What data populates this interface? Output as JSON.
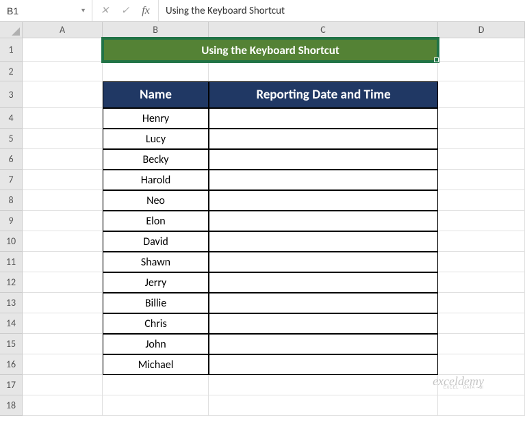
{
  "nameBox": "B1",
  "formulaValue": "Using the Keyboard Shortcut",
  "fx": {
    "cancel": "✕",
    "enter": "✓",
    "func": "fx"
  },
  "columns": [
    "A",
    "B",
    "C",
    "D"
  ],
  "rowNumbers": [
    "1",
    "2",
    "3",
    "4",
    "5",
    "6",
    "7",
    "8",
    "9",
    "10",
    "11",
    "12",
    "13",
    "14",
    "15",
    "16",
    "17",
    "18"
  ],
  "titleCell": "Using the Keyboard Shortcut",
  "headers": {
    "name": "Name",
    "reporting": "Reporting Date and Time"
  },
  "names": [
    "Henry",
    "Lucy",
    "Becky",
    "Harold",
    "Neo",
    "Elon",
    "David",
    "Shawn",
    "Jerry",
    "Billie",
    "Chris",
    "John",
    "Michael"
  ],
  "watermark": {
    "main": "exceldemy",
    "sub": "EXCEL · DATA · BI"
  },
  "chart_data": {
    "type": "table",
    "title": "Using the Keyboard Shortcut",
    "columns": [
      "Name",
      "Reporting Date and Time"
    ],
    "rows": [
      [
        "Henry",
        ""
      ],
      [
        "Lucy",
        ""
      ],
      [
        "Becky",
        ""
      ],
      [
        "Harold",
        ""
      ],
      [
        "Neo",
        ""
      ],
      [
        "Elon",
        ""
      ],
      [
        "David",
        ""
      ],
      [
        "Shawn",
        ""
      ],
      [
        "Jerry",
        ""
      ],
      [
        "Billie",
        ""
      ],
      [
        "Chris",
        ""
      ],
      [
        "John",
        ""
      ],
      [
        "Michael",
        ""
      ]
    ]
  }
}
